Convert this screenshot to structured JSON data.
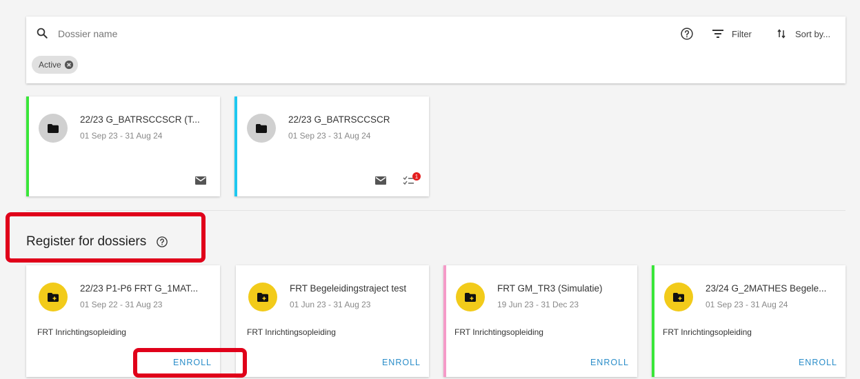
{
  "search": {
    "placeholder": "Dossier name",
    "filter_label": "Filter",
    "sort_label": "Sort by...",
    "active_chip": "Active"
  },
  "my_dossiers": [
    {
      "title": "22/23 G_BATRSCCSCR (T...",
      "dates": "01 Sep 23 - 31 Aug 24",
      "accent": "#39e639",
      "has_tasks": false
    },
    {
      "title": "22/23 G_BATRSCCSCR",
      "dates": "01 Sep 23 - 31 Aug 24",
      "accent": "#1ec8f0",
      "has_tasks": true,
      "task_badge": "1"
    }
  ],
  "register_section": {
    "title": "Register for dossiers"
  },
  "register_dossiers": [
    {
      "title": "22/23 P1-P6 FRT G_1MAT...",
      "dates": "01 Sep 22 - 31 Aug 23",
      "subtitle": "FRT Inrichtingsopleiding",
      "enroll": "ENROLL",
      "accent": "#ffffff"
    },
    {
      "title": "FRT Begeleidingstraject test",
      "dates": "01 Jun 23 - 31 Aug 23",
      "subtitle": "FRT Inrichtingsopleiding",
      "enroll": "ENROLL",
      "accent": "#ffffff"
    },
    {
      "title": "FRT GM_TR3 (Simulatie)",
      "dates": "19 Jun 23 - 31 Dec 23",
      "subtitle": "FRT Inrichtingsopleiding",
      "enroll": "ENROLL",
      "accent": "#f59ac8"
    },
    {
      "title": "23/24 G_2MATHES Begele...",
      "dates": "01 Sep 23 - 31 Aug 24",
      "subtitle": "FRT Inrichtingsopleiding",
      "enroll": "ENROLL",
      "accent": "#39e639"
    }
  ],
  "colors": {
    "folder_grey": "#d0d0d0",
    "folder_yellow": "#f2cb1a",
    "link_blue": "#2a8dc9",
    "highlight_red": "#e0001a"
  }
}
